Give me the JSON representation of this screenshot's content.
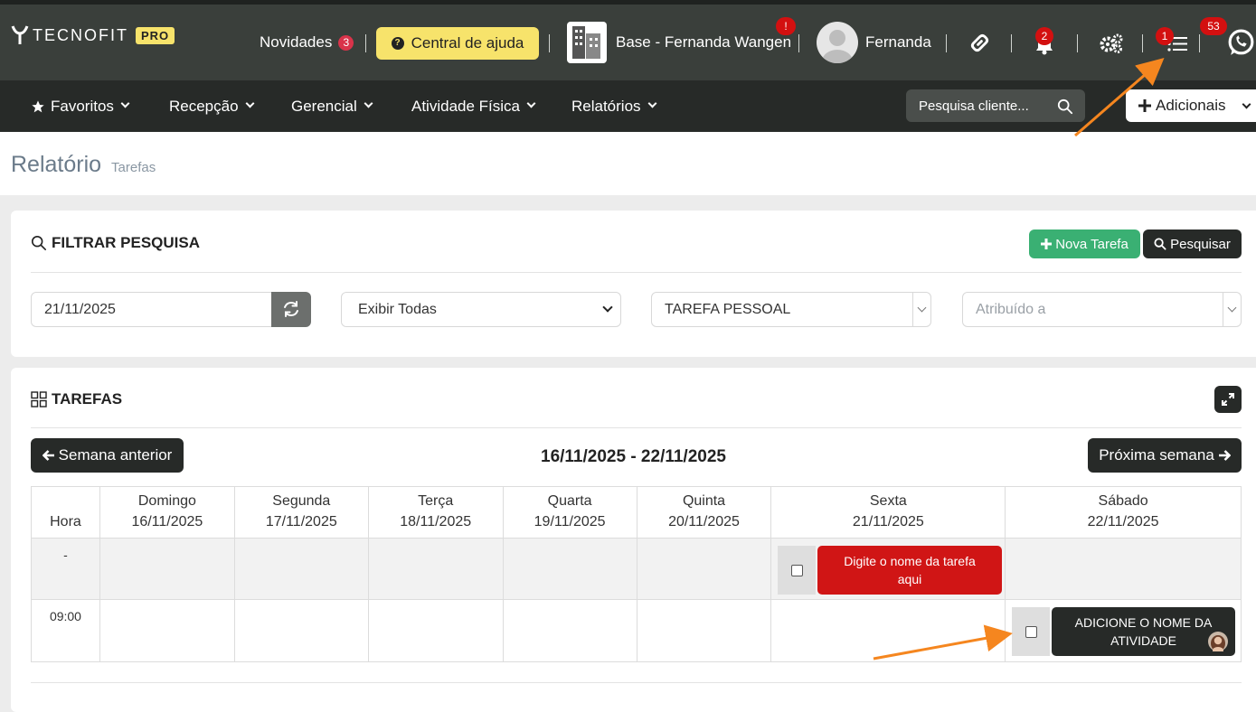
{
  "brand": {
    "name": "TECNOFIT",
    "tier": "PRO"
  },
  "topbar": {
    "news_label": "Novidades",
    "news_count": "3",
    "help_label": "Central de ajuda",
    "base_label": "Base - Fernanda Wangen",
    "base_alert": "!",
    "user_name": "Fernanda",
    "notifications_count": "2",
    "tasks_count": "1",
    "whatsapp_count": "53"
  },
  "nav": {
    "items": [
      {
        "label": "Favoritos"
      },
      {
        "label": "Recepção"
      },
      {
        "label": "Gerencial"
      },
      {
        "label": "Atividade Física"
      },
      {
        "label": "Relatórios"
      }
    ],
    "search_placeholder": "Pesquisa cliente...",
    "adicionais_label": "Adicionais"
  },
  "page": {
    "title": "Relatório",
    "subtitle": "Tarefas"
  },
  "filter": {
    "title": "FILTRAR PESQUISA",
    "new_task_label": "Nova Tarefa",
    "search_label": "Pesquisar",
    "date_value": "21/11/2025",
    "show_value": "Exibir Todas",
    "type_value": "TAREFA PESSOAL",
    "assigned_placeholder": "Atribuído a"
  },
  "tasks": {
    "title": "TAREFAS",
    "prev_week_label": "Semana anterior",
    "next_week_label": "Próxima semana",
    "week_range": "16/11/2025 - 22/11/2025",
    "hour_header": "Hora",
    "days": [
      {
        "name": "Domingo",
        "date": "16/11/2025"
      },
      {
        "name": "Segunda",
        "date": "17/11/2025"
      },
      {
        "name": "Terça",
        "date": "18/11/2025"
      },
      {
        "name": "Quarta",
        "date": "19/11/2025"
      },
      {
        "name": "Quinta",
        "date": "20/11/2025"
      },
      {
        "name": "Sexta",
        "date": "21/11/2025"
      },
      {
        "name": "Sábado",
        "date": "22/11/2025"
      }
    ],
    "rows": [
      {
        "hour": "-"
      },
      {
        "hour": "09:00"
      }
    ],
    "task_red": "Digite o nome da tarefa aqui",
    "task_dark": "ADICIONE O NOME DA ATIVIDADE"
  },
  "colors": {
    "topbar": "#3a3f3b",
    "navbar": "#272a28",
    "help_yellow": "#f7e36b",
    "green": "#3ab073",
    "task_red": "#d01515",
    "task_dark": "#272a28",
    "arrow_orange": "#f5861f"
  }
}
